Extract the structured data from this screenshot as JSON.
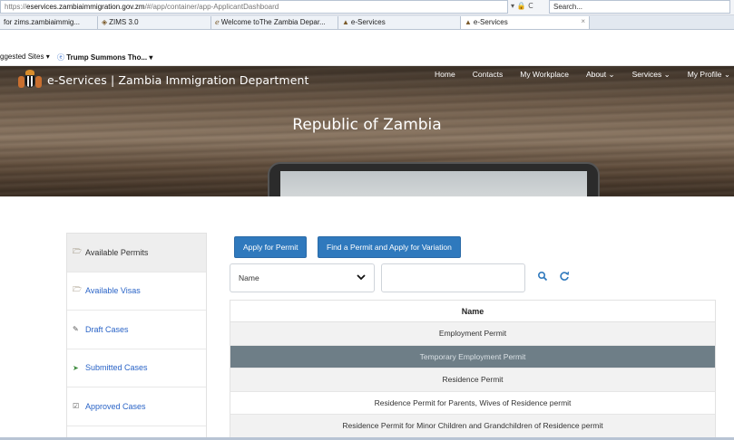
{
  "browser": {
    "url_prefix": "https://",
    "url_host": "eservices.zambiaimmigration.gov.zm",
    "url_path": "/#/app/container/app-ApplicantDashboard",
    "address_controls": "▾ 🔒 C",
    "search_placeholder": "Search...",
    "tabs": [
      {
        "label": "for zims.zambiaimmig..."
      },
      {
        "label": "ZIMS 3.0"
      },
      {
        "label": "Welcome toThe Zambia Depar..."
      },
      {
        "label": "e-Services"
      },
      {
        "label": "e-Services"
      }
    ],
    "tab_close": "×",
    "favorites": [
      {
        "label": "ggested Sites ▾"
      },
      {
        "label": "Trump Summons Tho... ▾"
      }
    ]
  },
  "header": {
    "brand_title": "e-Services | Zambia Immigration Department",
    "nav": [
      "Home",
      "Contacts",
      "My Workplace",
      "About ⌄",
      "Services ⌄",
      "My Profile ⌄"
    ],
    "hero_title": "Republic of Zambia"
  },
  "sidebar": {
    "items": [
      {
        "label": "Available Permits",
        "icon": "folder-open-icon",
        "glyph": "🗁"
      },
      {
        "label": "Available Visas",
        "icon": "folder-open-icon",
        "glyph": "🗁"
      },
      {
        "label": "Draft Cases",
        "icon": "edit-icon",
        "glyph": "✎"
      },
      {
        "label": "Submitted Cases",
        "icon": "send-icon",
        "glyph": "➤"
      },
      {
        "label": "Approved Cases",
        "icon": "check-square-icon",
        "glyph": "☑"
      }
    ]
  },
  "actions": {
    "apply": "Apply for Permit",
    "find": "Find a Permit and Apply for Variation"
  },
  "filter": {
    "select_value": "Name",
    "search_icon": "search-icon",
    "refresh_icon": "refresh-icon"
  },
  "table": {
    "header": "Name",
    "rows": [
      "Employment Permit",
      "Temporary Employment Permit",
      "Residence Permit",
      "Residence Permit for Parents, Wives of Residence permit",
      "Residence Permit for Minor Children and Grandchildren of Residence permit"
    ]
  },
  "colors": {
    "primary_button": "#2f79bd",
    "selected_row": "#6e7e87",
    "link": "#2a64c7"
  }
}
